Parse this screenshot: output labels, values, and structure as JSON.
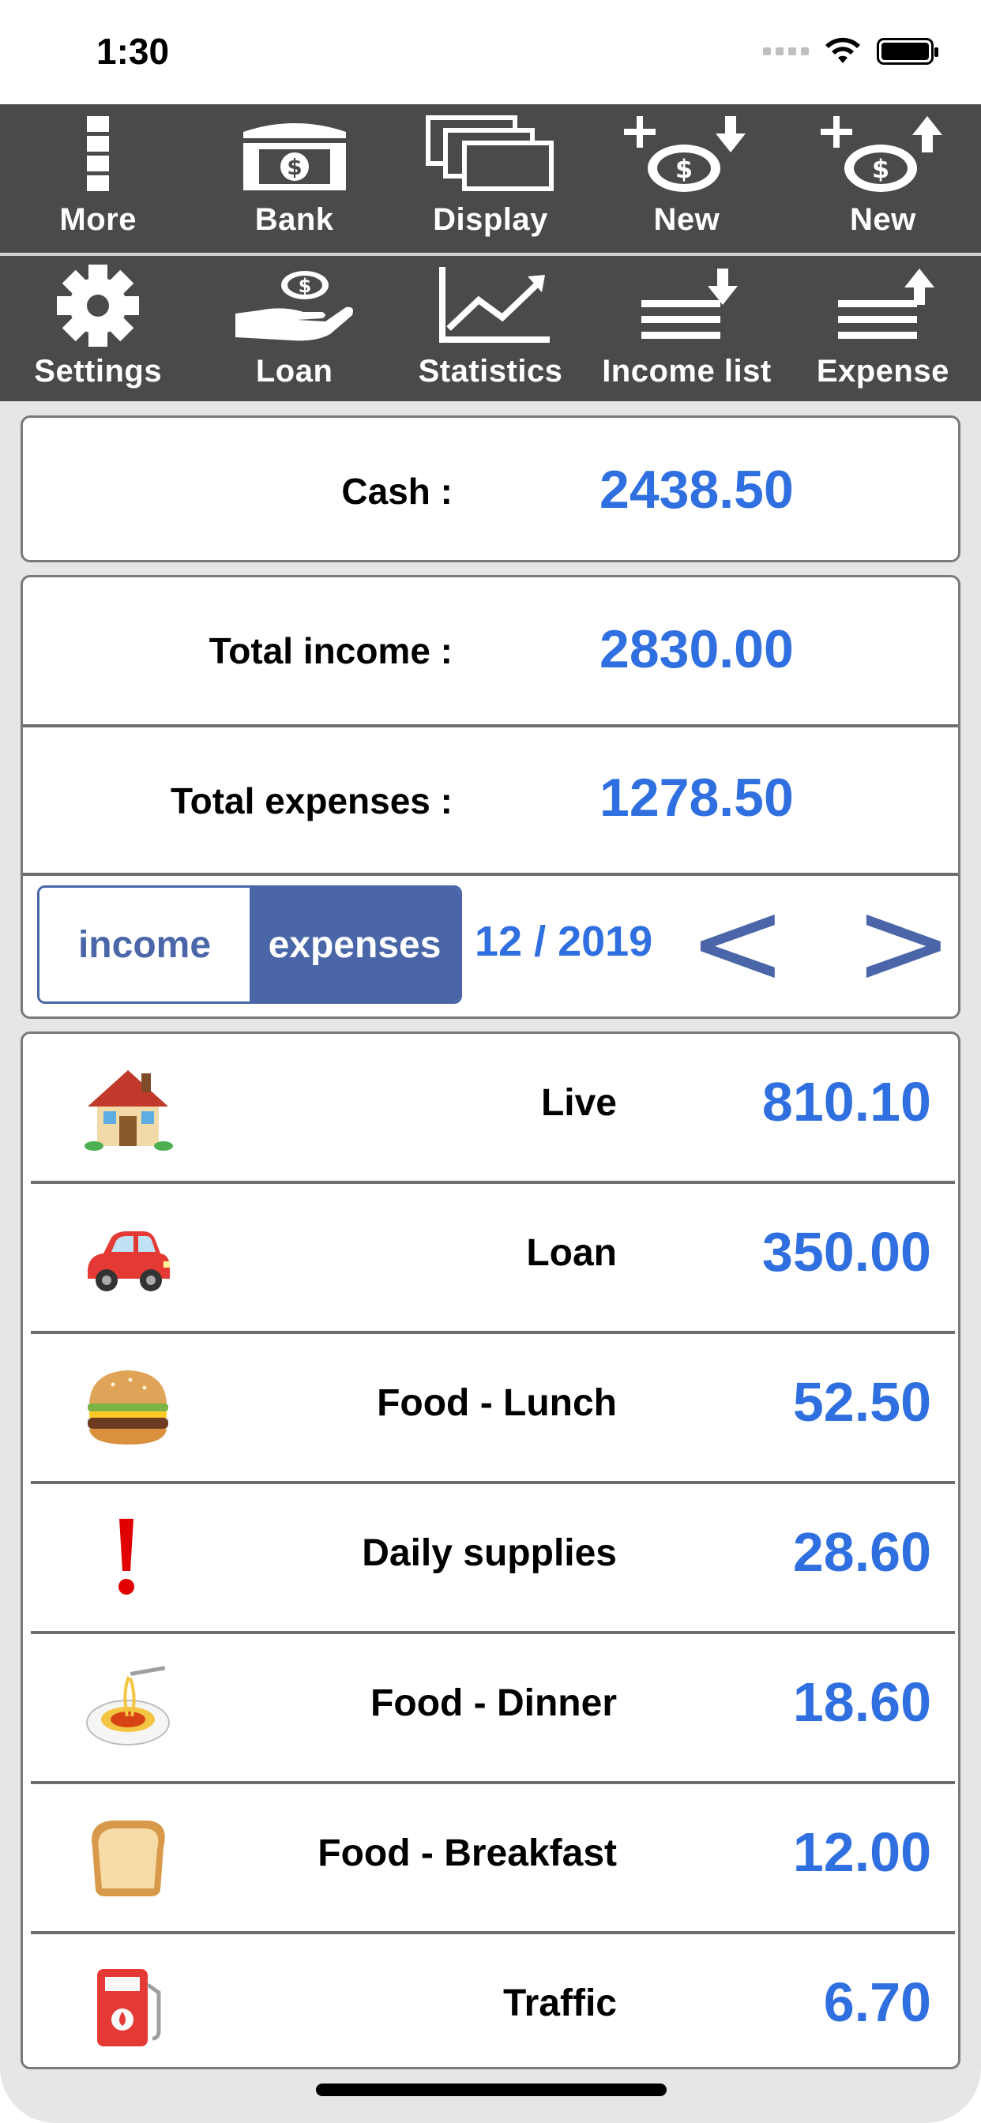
{
  "status_bar": {
    "time": "1:30"
  },
  "toolbar_top": [
    {
      "label": "More",
      "icon": "more-icon"
    },
    {
      "label": "Bank",
      "icon": "bank-icon"
    },
    {
      "label": "Display",
      "icon": "display-icon"
    },
    {
      "label": "New",
      "icon": "new-income-icon"
    },
    {
      "label": "New",
      "icon": "new-expense-icon"
    }
  ],
  "toolbar_bottom": [
    {
      "label": "Settings",
      "icon": "gear-icon"
    },
    {
      "label": "Loan",
      "icon": "loan-icon"
    },
    {
      "label": "Statistics",
      "icon": "statistics-icon"
    },
    {
      "label": "Income list",
      "icon": "income-list-icon"
    },
    {
      "label": "Expense",
      "icon": "expense-list-icon"
    }
  ],
  "summary": {
    "cash_label": "Cash :",
    "cash_value": "2438.50",
    "total_income_label": "Total income :",
    "total_income_value": "2830.00",
    "total_expenses_label": "Total expenses :",
    "total_expenses_value": "1278.50"
  },
  "filter": {
    "income_label": "income",
    "expenses_label": "expenses",
    "selected": "expenses",
    "month": "12 / 2019",
    "prev": "<",
    "next": ">"
  },
  "expenses": [
    {
      "category": "Live",
      "amount": "810.10",
      "icon": "house-icon"
    },
    {
      "category": "Loan",
      "amount": "350.00",
      "icon": "car-icon"
    },
    {
      "category": "Food - Lunch",
      "amount": "52.50",
      "icon": "hamburger-icon"
    },
    {
      "category": "Daily supplies",
      "amount": "28.60",
      "icon": "exclamation-icon"
    },
    {
      "category": "Food - Dinner",
      "amount": "18.60",
      "icon": "spaghetti-icon"
    },
    {
      "category": "Food - Breakfast",
      "amount": "12.00",
      "icon": "bread-icon"
    },
    {
      "category": "Traffic",
      "amount": "6.70",
      "icon": "fuel-pump-icon"
    }
  ],
  "colors": {
    "toolbar": "#4a4a4a",
    "value_blue": "#2f6fe0",
    "segment_blue": "#4a66a8"
  }
}
